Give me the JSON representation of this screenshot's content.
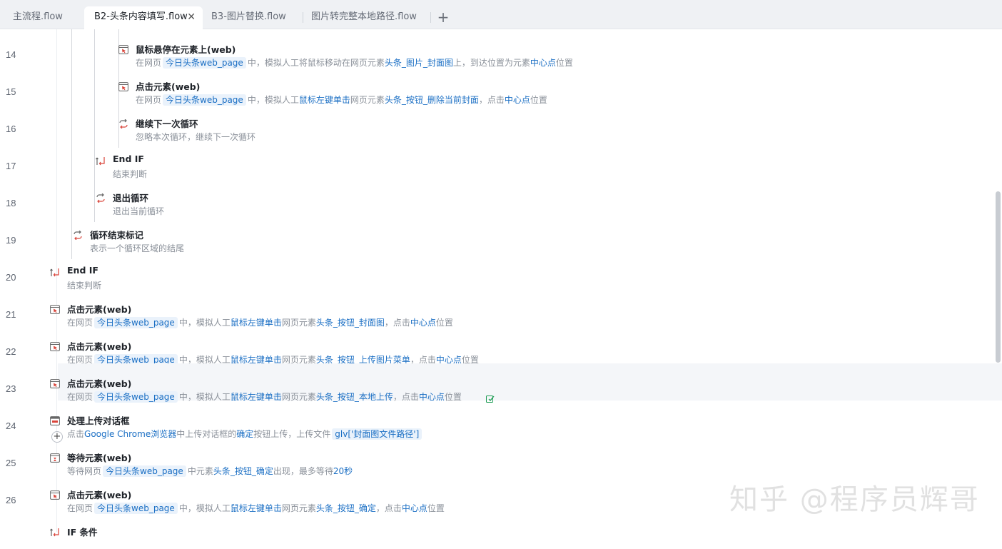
{
  "tabs": [
    {
      "label": "主流程.flow",
      "active": false
    },
    {
      "label": "B2-头条内容填写.flow",
      "active": true
    },
    {
      "label": "B3-图片替换.flow",
      "active": false
    },
    {
      "label": "图片转完整本地路径.flow",
      "active": false
    }
  ],
  "tab_close": "✕",
  "tab_add": "+",
  "row_add": "+",
  "watermark": "知乎 @程序员辉哥",
  "lines": [
    {
      "no": "14",
      "title": "鼠标悬停在元素上(web)",
      "icon": "hover-icon",
      "desc": [
        {
          "t": "在网页"
        },
        {
          "t": "今日头条web_page",
          "s": "pill"
        },
        {
          "t": "中，模拟人工将鼠标移动在网页元素"
        },
        {
          "t": "头条_图片_封面图",
          "s": "b"
        },
        {
          "t": "上，到达位置为元素"
        },
        {
          "t": "中心点",
          "s": "b"
        },
        {
          "t": "位置"
        }
      ]
    },
    {
      "no": "15",
      "title": "点击元素(web)",
      "icon": "click-icon",
      "desc": [
        {
          "t": "在网页"
        },
        {
          "t": "今日头条web_page",
          "s": "pill"
        },
        {
          "t": "中，模拟人工"
        },
        {
          "t": "鼠标左键单击",
          "s": "b"
        },
        {
          "t": "网页元素"
        },
        {
          "t": "头条_按钮_删除当前封面",
          "s": "b"
        },
        {
          "t": "，点击"
        },
        {
          "t": "中心点",
          "s": "b"
        },
        {
          "t": "位置"
        }
      ]
    },
    {
      "no": "16",
      "title": "继续下一次循环",
      "icon": "loop-continue-icon",
      "desc": [
        {
          "t": "忽略本次循环，继续下一次循环"
        }
      ]
    },
    {
      "no": "17",
      "title": "End IF",
      "icon": "end-if-icon",
      "desc": [
        {
          "t": "结束判断"
        }
      ]
    },
    {
      "no": "18",
      "title": "退出循环",
      "icon": "loop-exit-icon",
      "desc": [
        {
          "t": "退出当前循环"
        }
      ]
    },
    {
      "no": "19",
      "title": "循环结束标记",
      "icon": "loop-end-icon",
      "desc": [
        {
          "t": "表示一个循环区域的结尾"
        }
      ]
    },
    {
      "no": "20",
      "title": "End IF",
      "icon": "end-if-icon",
      "desc": [
        {
          "t": "结束判断"
        }
      ]
    },
    {
      "no": "21",
      "title": "点击元素(web)",
      "icon": "click-icon",
      "desc": [
        {
          "t": "在网页"
        },
        {
          "t": "今日头条web_page",
          "s": "pill"
        },
        {
          "t": "中，模拟人工"
        },
        {
          "t": "鼠标左键单击",
          "s": "b"
        },
        {
          "t": "网页元素"
        },
        {
          "t": "头条_按钮_封面图",
          "s": "b"
        },
        {
          "t": "，点击"
        },
        {
          "t": "中心点",
          "s": "b"
        },
        {
          "t": "位置"
        }
      ]
    },
    {
      "no": "22",
      "title": "点击元素(web)",
      "icon": "click-icon",
      "desc": [
        {
          "t": "在网页"
        },
        {
          "t": "今日头条web_page",
          "s": "pill"
        },
        {
          "t": "中，模拟人工"
        },
        {
          "t": "鼠标左键单击",
          "s": "b"
        },
        {
          "t": "网页元素"
        },
        {
          "t": "头条_按钮_上传图片菜单",
          "s": "b"
        },
        {
          "t": "，点击"
        },
        {
          "t": "中心点",
          "s": "b"
        },
        {
          "t": "位置"
        }
      ]
    },
    {
      "no": "23",
      "title": "点击元素(web)",
      "icon": "click-icon",
      "desc": [
        {
          "t": "在网页"
        },
        {
          "t": "今日头条web_page",
          "s": "pill"
        },
        {
          "t": "中，模拟人工"
        },
        {
          "t": "鼠标左键单击",
          "s": "b"
        },
        {
          "t": "网页元素"
        },
        {
          "t": "头条_按钮_本地上传",
          "s": "b"
        },
        {
          "t": "，点击"
        },
        {
          "t": "中心点",
          "s": "b"
        },
        {
          "t": "位置"
        }
      ]
    },
    {
      "no": "24",
      "title": "处理上传对话框",
      "icon": "dialog-icon",
      "desc": [
        {
          "t": "点击"
        },
        {
          "t": "Google Chrome浏览器",
          "s": "b"
        },
        {
          "t": "中上传对话框的"
        },
        {
          "t": "确定",
          "s": "b"
        },
        {
          "t": "按钮上传，上传文件"
        },
        {
          "t": "glv['封面图文件路径']",
          "s": "pill"
        }
      ]
    },
    {
      "no": "25",
      "title": "等待元素(web)",
      "icon": "wait-icon",
      "desc": [
        {
          "t": "等待网页"
        },
        {
          "t": "今日头条web_page",
          "s": "pill"
        },
        {
          "t": "中元素"
        },
        {
          "t": "头条_按钮_确定",
          "s": "b"
        },
        {
          "t": "出现，最多等待"
        },
        {
          "t": "20秒",
          "s": "b"
        }
      ]
    },
    {
      "no": "26",
      "title": "点击元素(web)",
      "icon": "click-icon",
      "desc": [
        {
          "t": "在网页"
        },
        {
          "t": "今日头条web_page",
          "s": "pill"
        },
        {
          "t": "中，模拟人工"
        },
        {
          "t": "鼠标左键单击",
          "s": "b"
        },
        {
          "t": "网页元素"
        },
        {
          "t": "头条_按钮_确定",
          "s": "b"
        },
        {
          "t": "，点击"
        },
        {
          "t": "中心点",
          "s": "b"
        },
        {
          "t": "位置"
        }
      ]
    },
    {
      "no": "",
      "title": "IF 条件",
      "icon": "if-icon",
      "desc": []
    }
  ]
}
